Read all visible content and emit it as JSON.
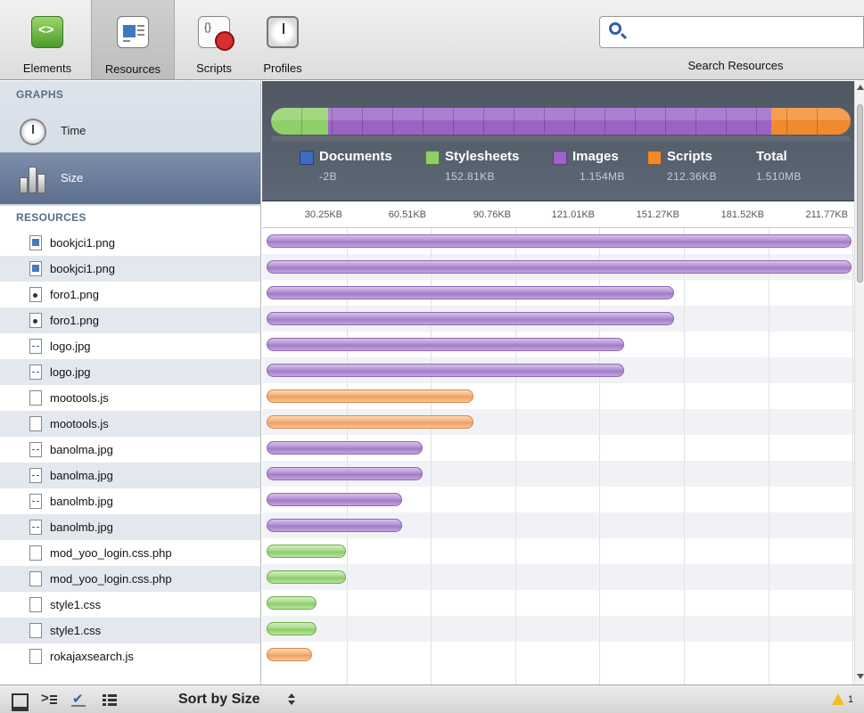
{
  "toolbar": {
    "panels": [
      {
        "id": "elements",
        "label": "Elements",
        "icon": "elements-icon",
        "active": false
      },
      {
        "id": "resources",
        "label": "Resources",
        "icon": "resources-icon",
        "active": true
      },
      {
        "id": "scripts",
        "label": "Scripts",
        "icon": "scripts-icon",
        "active": false
      },
      {
        "id": "profiles",
        "label": "Profiles",
        "icon": "profiles-icon",
        "active": false
      }
    ],
    "search": {
      "value": "",
      "placeholder": "",
      "label": "Search Resources"
    }
  },
  "sidebar": {
    "graphs_title": "GRAPHS",
    "graphs": [
      {
        "label": "Time",
        "icon": "clock-icon",
        "selected": false
      },
      {
        "label": "Size",
        "icon": "size-icon",
        "selected": true
      }
    ],
    "resources_title": "RESOURCES",
    "resources": [
      {
        "name": "bookjci1.png",
        "type": "png",
        "category": "images",
        "size_kb": 234.0
      },
      {
        "name": "bookjci1.png",
        "type": "png",
        "category": "images",
        "size_kb": 234.0
      },
      {
        "name": "foro1.png",
        "type": "foro",
        "category": "images",
        "size_kb": 163.5
      },
      {
        "name": "foro1.png",
        "type": "foro",
        "category": "images",
        "size_kb": 163.5
      },
      {
        "name": "logo.jpg",
        "type": "jpg",
        "category": "images",
        "size_kb": 144.0
      },
      {
        "name": "logo.jpg",
        "type": "jpg",
        "category": "images",
        "size_kb": 144.0
      },
      {
        "name": "mootools.js",
        "type": "js",
        "category": "scripts",
        "size_kb": 84.3
      },
      {
        "name": "mootools.js",
        "type": "js",
        "category": "scripts",
        "size_kb": 84.3
      },
      {
        "name": "banolma.jpg",
        "type": "jpg",
        "category": "images",
        "size_kb": 64.0
      },
      {
        "name": "banolma.jpg",
        "type": "jpg",
        "category": "images",
        "size_kb": 64.0
      },
      {
        "name": "banolmb.jpg",
        "type": "jpg",
        "category": "images",
        "size_kb": 56.0
      },
      {
        "name": "banolmb.jpg",
        "type": "jpg",
        "category": "images",
        "size_kb": 56.0
      },
      {
        "name": "mod_yoo_login.css.php",
        "type": "doc",
        "category": "stylesheets",
        "size_kb": 33.5
      },
      {
        "name": "mod_yoo_login.css.php",
        "type": "doc",
        "category": "stylesheets",
        "size_kb": 33.5
      },
      {
        "name": "style1.css",
        "type": "doc",
        "category": "stylesheets",
        "size_kb": 22.0
      },
      {
        "name": "style1.css",
        "type": "doc",
        "category": "stylesheets",
        "size_kb": 22.0
      },
      {
        "name": "rokajaxsearch.js",
        "type": "js",
        "category": "scripts",
        "size_kb": 20.0
      }
    ]
  },
  "summary": {
    "legend": [
      {
        "label": "Documents",
        "value": "-2B",
        "color": "#3d6cc3"
      },
      {
        "label": "Stylesheets",
        "value": "152.81KB",
        "color": "#8fcf67"
      },
      {
        "label": "Images",
        "value": "1.154MB",
        "color": "#9a63c6"
      },
      {
        "label": "Scripts",
        "value": "212.36KB",
        "color": "#f08a2c"
      },
      {
        "label": "Total",
        "value": "1.510MB",
        "color": ""
      }
    ],
    "bar_fractions": {
      "documents": 0.0,
      "stylesheets": 0.099,
      "images": 0.764,
      "scripts": 0.137
    }
  },
  "ruler": {
    "ticks": [
      "30.25KB",
      "60.51KB",
      "90.76KB",
      "121.01KB",
      "151.27KB",
      "181.52KB",
      "211.77KB"
    ],
    "tick_step_kb": 30.25
  },
  "statusbar": {
    "sort_label": "Sort by Size",
    "warning_count": "1"
  },
  "colors": {
    "images": "#a07cc4",
    "scripts": "#eea062",
    "stylesheets": "#8ccc68",
    "documents": "#3d6cc3"
  }
}
